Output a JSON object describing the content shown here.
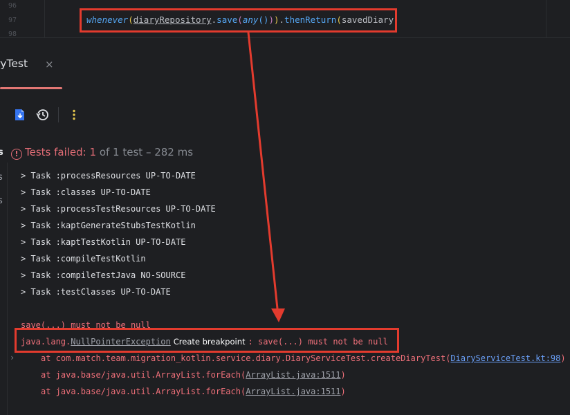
{
  "editor": {
    "line_numbers": [
      "96",
      "97",
      "98"
    ],
    "code": {
      "whenever": "whenever",
      "open1": "(",
      "repo": "diaryRepository",
      "dot1": ".",
      "save": "save",
      "open2": "(",
      "any": "any",
      "parens": "()",
      "close2": ")",
      "close1": ")",
      "dot2": ".",
      "then_return": "thenReturn",
      "open3": "(",
      "saved": "savedDiary",
      "close3": ")"
    }
  },
  "tool_window": {
    "tab_title": "ryTest",
    "tab_close": "×",
    "status": {
      "icon": "!",
      "label": "Tests failed: ",
      "failed": "1",
      "of_total": " of 1 test",
      "duration": " – 282 ms"
    },
    "left_edge_letters": [
      "s",
      "s",
      "s"
    ],
    "console": {
      "tasks": [
        "> Task :processResources UP-TO-DATE",
        "> Task :classes UP-TO-DATE",
        "> Task :processTestResources UP-TO-DATE",
        "> Task :kaptGenerateStubsTestKotlin",
        "> Task :kaptTestKotlin UP-TO-DATE",
        "> Task :compileTestKotlin",
        "> Task :compileTestJava NO-SOURCE",
        "> Task :testClasses UP-TO-DATE"
      ],
      "error_partial": "save(...) must not be null",
      "exception_prefix": "java.lang.",
      "exception_name": "NullPointerException",
      "create_breakpoint": "Create breakpoint",
      "exception_message": ": save(...) must not be null",
      "expand_chevron": "›",
      "stack": [
        {
          "prefix": "at com.match.team.migration_kotlin.service.diary.DiaryServiceTest.createDiaryTest(",
          "link": "DiaryServiceTest.kt:98",
          "suffix": ") <"
        },
        {
          "prefix": "at java.base/java.util.ArrayList.forEach(",
          "link": "ArrayList.java:1511",
          "suffix": ")"
        },
        {
          "prefix": "at java.base/java.util.ArrayList.forEach(",
          "link": "ArrayList.java:1511",
          "suffix": ")"
        }
      ]
    }
  },
  "colors": {
    "annotation": "#e33b2e",
    "failed_text": "#e06c75",
    "link": "#6a9ff7",
    "background": "#1e1f22"
  },
  "icons": [
    "pin-icon",
    "export-test-results-icon",
    "test-history-icon",
    "more-options-icon",
    "warning-circle-icon"
  ]
}
